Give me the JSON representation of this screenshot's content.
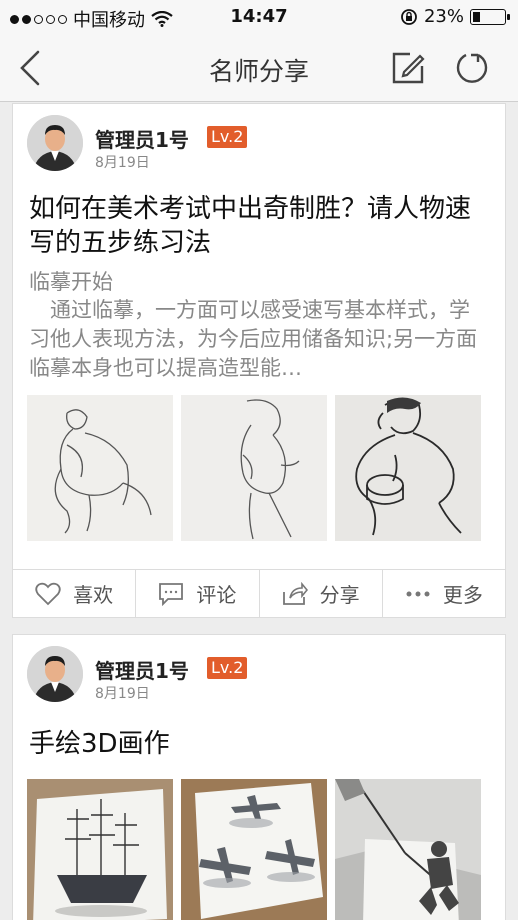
{
  "status_bar": {
    "carrier": "中国移动",
    "time": "14:47",
    "battery_text": "23%",
    "battery_level": 0.23,
    "signal_bars": 2
  },
  "nav": {
    "title": "名师分享",
    "back_icon": "chevron-left-icon",
    "edit_icon": "compose-icon",
    "refresh_icon": "refresh-icon"
  },
  "posts": [
    {
      "author": "管理员1号",
      "level": "Lv.2",
      "date": "8月19日",
      "title": "如何在美术考试中出奇制胜？请人物速写的五步练习法",
      "subhead": "临摹开始",
      "excerpt": "通过临摹，一方面可以感受速写基本样式，学习他人表现方法，为今后应用储备知识;另一方面临摹本身也可以提高造型能…",
      "images": [
        "sitting-figure-sketch",
        "standing-figure-sketch",
        "crouching-worker-sketch"
      ],
      "actions": [
        {
          "icon": "heart-icon",
          "label": "喜欢"
        },
        {
          "icon": "comment-icon",
          "label": "评论"
        },
        {
          "icon": "share-icon",
          "label": "分享"
        },
        {
          "icon": "more-icon",
          "label": "更多"
        }
      ]
    },
    {
      "author": "管理员1号",
      "level": "Lv.2",
      "date": "8月19日",
      "title": "手绘3D画作",
      "images": [
        "3d-ship-drawing",
        "3d-airplanes-drawing",
        "3d-figure-pulling-drawing"
      ]
    }
  ],
  "colors": {
    "accent_badge": "#e25d2b",
    "background": "#ededed"
  }
}
